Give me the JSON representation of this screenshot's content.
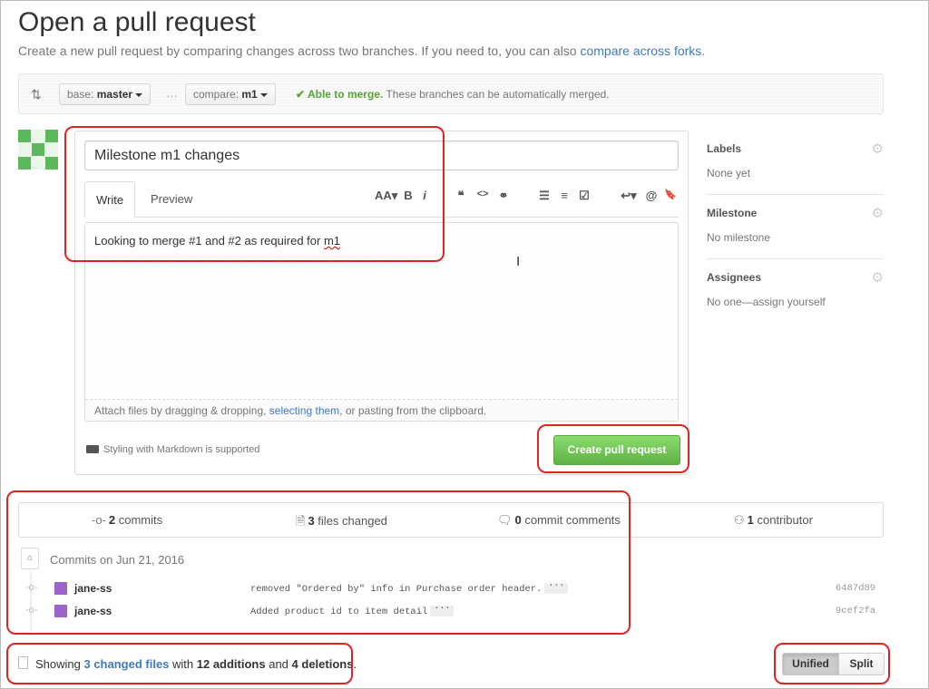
{
  "page": {
    "title": "Open a pull request",
    "subtitle": "Create a new pull request by comparing changes across two branches. If you need to, you can also ",
    "subtitle_link": "compare across forks",
    "subtitle_end": "."
  },
  "range": {
    "icon": "compare-arrows-icon",
    "base_label": "base:",
    "base_value": "master",
    "dots": "…",
    "compare_label": "compare:",
    "compare_value": "m1",
    "merge_ok": "✔ Able to merge.",
    "merge_text": " These branches can be automatically merged."
  },
  "form": {
    "title_value": "Milestone m1 changes",
    "tabs": [
      "Write",
      "Preview"
    ],
    "toolbar": [
      "AA▾",
      "B",
      "i",
      "❝",
      "<>",
      "⚭",
      "☰",
      "≡",
      "☑",
      "↩▾",
      "@",
      "🔖"
    ],
    "body_pre": "Looking to merge #1 and #2 as required for ",
    "body_misspelled": "m1",
    "attach_pre": "Attach files by dragging & dropping, ",
    "attach_link": "selecting them",
    "attach_post": ", or pasting from the clipboard.",
    "markdown_note": "Styling with Markdown is supported",
    "submit": "Create pull request"
  },
  "sidebar": [
    {
      "heading": "Labels",
      "value": "None yet"
    },
    {
      "heading": "Milestone",
      "value": "No milestone"
    },
    {
      "heading": "Assignees",
      "value": "No one—assign yourself"
    }
  ],
  "summary": {
    "commits_count": "2",
    "commits_label": " commits",
    "files_count": "3",
    "files_label": " files changed",
    "comments_count": "0",
    "comments_label": " commit comments",
    "contrib_count": "1",
    "contrib_label": " contributor"
  },
  "commits": {
    "date_label": "Commits on Jun 21, 2016",
    "items": [
      {
        "author": "jane-ss",
        "message": "removed \"Ordered by\" info in Purchase order header.",
        "sha": "6487d89"
      },
      {
        "author": "jane-ss",
        "message": "Added product id to item detail",
        "sha": "9cef2fa"
      }
    ]
  },
  "footer": {
    "showing_pre": "Showing ",
    "files_link": "3 changed files",
    "with": " with ",
    "additions": "12 additions",
    "and": " and ",
    "deletions": "4 deletions",
    "end": ".",
    "unified": "Unified",
    "split": "Split"
  },
  "colors": {
    "accent_link": "#4078c0",
    "merge_ok": "#55a532",
    "primary_button": "#60b044",
    "annotation": "#e02424"
  }
}
